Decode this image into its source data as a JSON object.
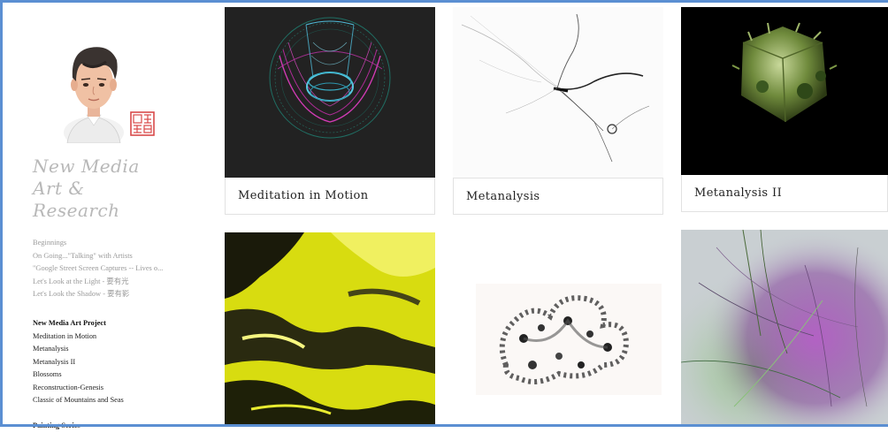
{
  "site": {
    "title_line1": "New Media",
    "title_line2": "Art &",
    "title_line3": "Research"
  },
  "nav": {
    "top_items": [
      "Beginnings",
      "On Going...\"Talking\" with Artists",
      "\"Google Street Screen Captures -- Lives o...",
      "Let's Look at the Light - 要有光",
      "Let's Look the Shadow - 要有影"
    ],
    "project_heading": "New Media Art Project",
    "project_items": [
      "Meditation in Motion",
      "Metanalysis",
      "Metanalysis II",
      "Blossoms",
      "Reconstruction-Genesis",
      "Classic of Mountains and Seas"
    ],
    "painting_heading": "Painting Series"
  },
  "gallery": {
    "captions": [
      "Meditation in Motion",
      "Metanalysis",
      "Metanalysis II"
    ]
  },
  "colors": {
    "frame": "#5b8fd2",
    "title_gray": "#b8b8b8",
    "nav_gray": "#9a9a9a"
  }
}
